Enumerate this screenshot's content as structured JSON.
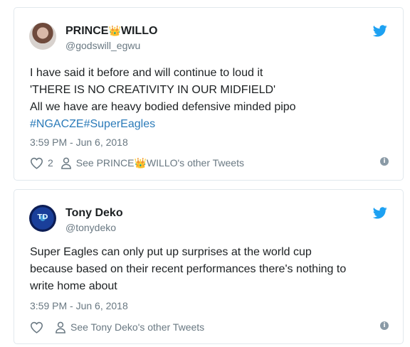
{
  "tweets": [
    {
      "author_name_part1": "PRINCE",
      "author_name_part2": "WILLO",
      "crown_emoji": "👑",
      "handle": "@godswill_egwu",
      "text_lines": [
        "I have said it before and will continue to loud it",
        "'THERE IS NO CREATIVITY IN OUR MIDFIELD'",
        "All we have are heavy bodied defensive minded pipo"
      ],
      "hashtags": "#NGACZE#SuperEagles",
      "timestamp": "3:59 PM - Jun 6, 2018",
      "like_count": "2",
      "profile_link_part1": "See PRINCE",
      "profile_link_part2": "WILLO's other Tweets",
      "avatar_icon": "profile-photo",
      "logo_icon": "twitter-bird"
    },
    {
      "author_name": "Tony Deko",
      "handle": "@tonydeko",
      "avatar_text": "TD",
      "text_lines": [
        "Super Eagles can only put up surprises at the world cup",
        "because based on their recent performances there's nothing to",
        "write home about"
      ],
      "timestamp": "3:59 PM - Jun 6, 2018",
      "like_count": "",
      "profile_link": "See Tony Deko's other Tweets",
      "avatar_icon": "profile-photo",
      "logo_icon": "twitter-bird"
    }
  ],
  "colors": {
    "link": "#2b7bb9",
    "twitter_blue": "#1da1f2",
    "meta_gray": "#697882",
    "border": "#e1e8ed",
    "text": "#1c2022"
  }
}
